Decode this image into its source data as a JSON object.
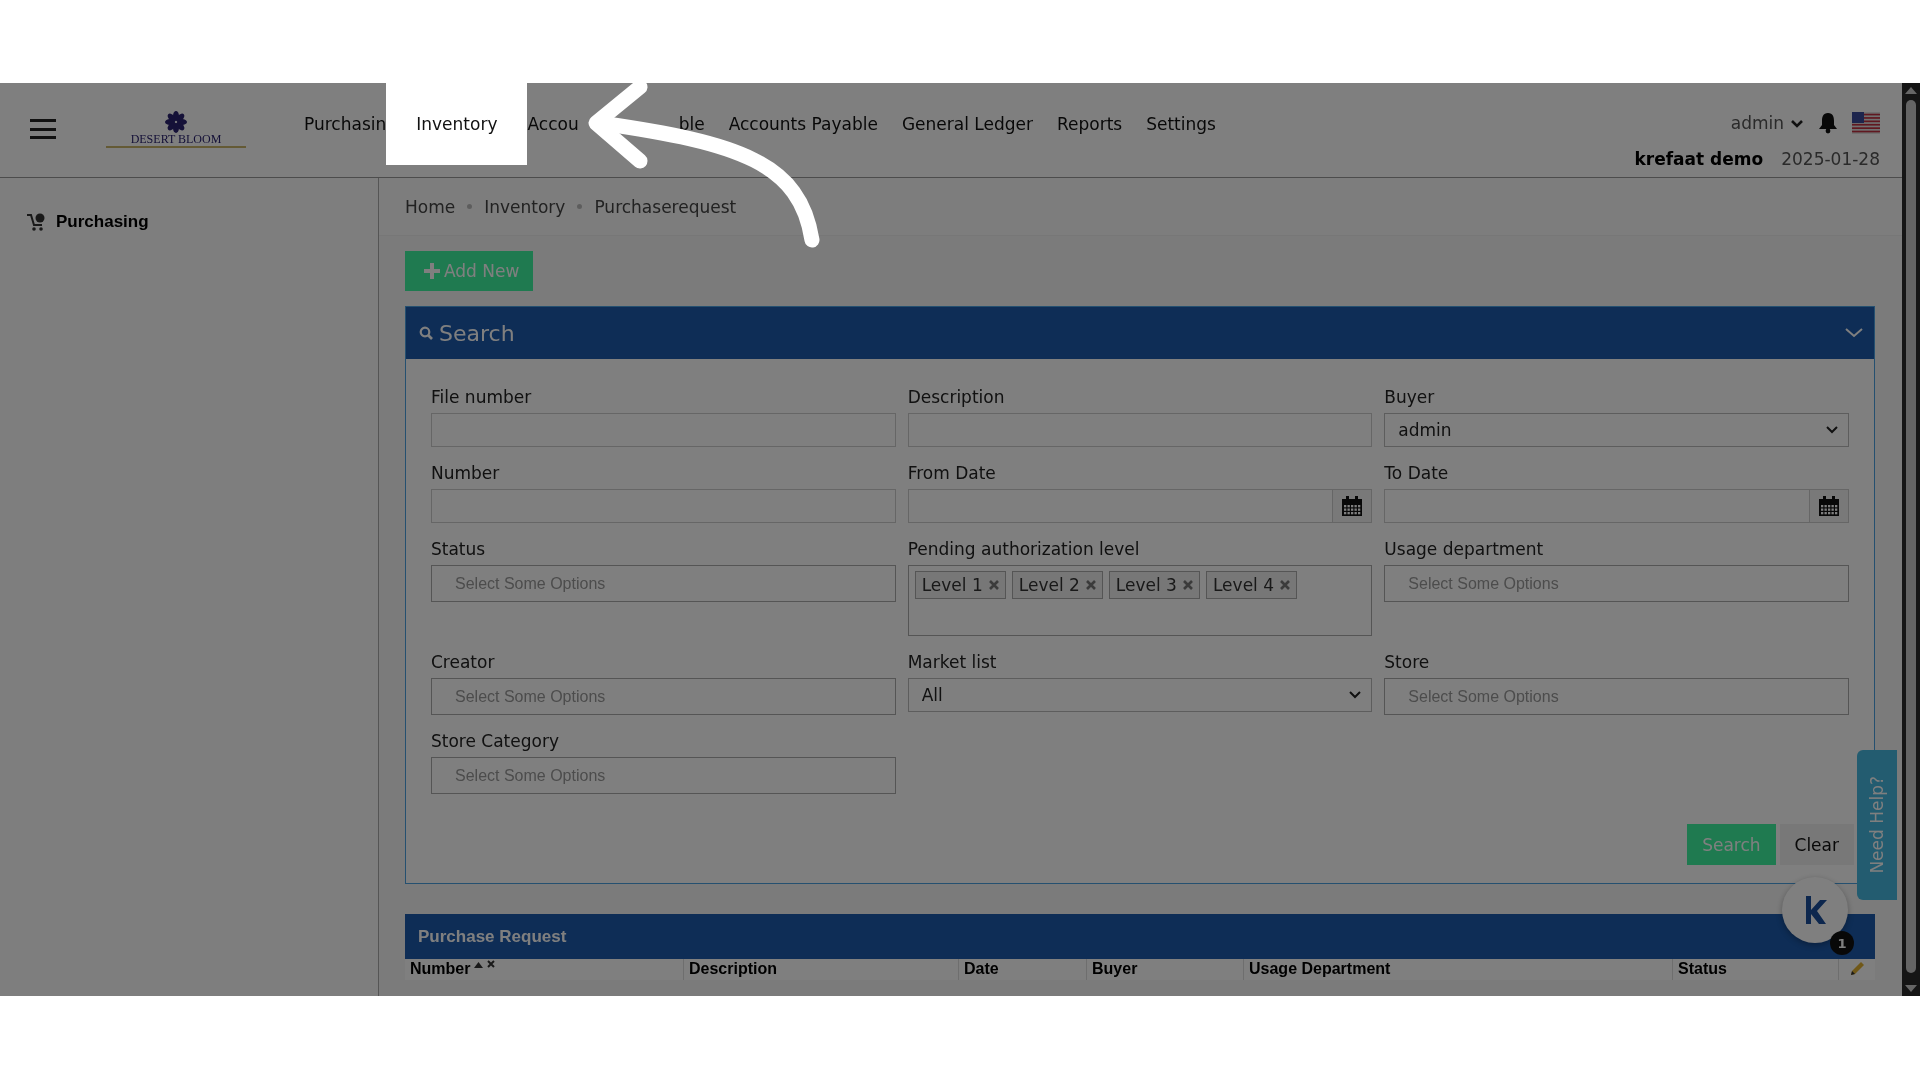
{
  "header": {
    "logo_text": "DESERT BLOOM",
    "nav": [
      {
        "label": "Purchasin",
        "highlighted": false
      },
      {
        "label": "Inventory",
        "highlighted": true
      },
      {
        "label": "Accou",
        "label_tail": "ble",
        "highlighted": false
      },
      {
        "label": "Accounts Payable",
        "highlighted": false
      },
      {
        "label": "General Ledger",
        "highlighted": false
      },
      {
        "label": "Reports",
        "highlighted": false
      },
      {
        "label": "Settings",
        "highlighted": false
      }
    ],
    "user": "admin",
    "company": "krefaat demo",
    "date": "2025-01-28"
  },
  "sidebar": {
    "items": [
      {
        "label": "Purchasing"
      }
    ]
  },
  "breadcrumb": [
    "Home",
    "Inventory",
    "Purchaserequest"
  ],
  "add_button": "Add New",
  "search_panel": {
    "title": "Search",
    "expanded": true,
    "fields": [
      {
        "label": "File number",
        "kind": "text"
      },
      {
        "label": "Description",
        "kind": "text"
      },
      {
        "label": "Buyer",
        "kind": "select",
        "value": "admin"
      },
      {
        "label": "Number",
        "kind": "text"
      },
      {
        "label": "From Date",
        "kind": "date"
      },
      {
        "label": "To Date",
        "kind": "date"
      },
      {
        "label": "Status",
        "kind": "multi",
        "placeholder": "Select Some Options"
      },
      {
        "label": "Pending authorization level",
        "kind": "tags",
        "tags": [
          "Level 1",
          "Level 2",
          "Level 3",
          "Level 4"
        ]
      },
      {
        "label": "Usage department",
        "kind": "multi",
        "placeholder": "Select Some Options"
      },
      {
        "label": "Creator",
        "kind": "multi",
        "placeholder": "Select Some Options"
      },
      {
        "label": "Market list",
        "kind": "select",
        "value": "All"
      },
      {
        "label": "Store",
        "kind": "multi",
        "placeholder": "Select Some Options"
      },
      {
        "label": "Store Category",
        "kind": "multi",
        "placeholder": "Select Some Options"
      }
    ],
    "buttons": [
      {
        "label": "Search",
        "kind": "primary"
      },
      {
        "label": "Clear",
        "kind": "secondary"
      }
    ]
  },
  "results": {
    "title": "Purchase Request",
    "columns": [
      {
        "label": "Number",
        "sorted": true,
        "removable": true
      },
      {
        "label": "Description",
        "sorted": false,
        "removable": false
      },
      {
        "label": "Date",
        "sorted": false,
        "removable": false
      },
      {
        "label": "Buyer",
        "sorted": false,
        "removable": false
      },
      {
        "label": "Usage Department",
        "sorted": false,
        "removable": false
      },
      {
        "label": "Status",
        "sorted": false,
        "removable": false
      }
    ]
  },
  "help_tab": {
    "label": "Need Help?"
  },
  "chat": {
    "badge": "1"
  }
}
